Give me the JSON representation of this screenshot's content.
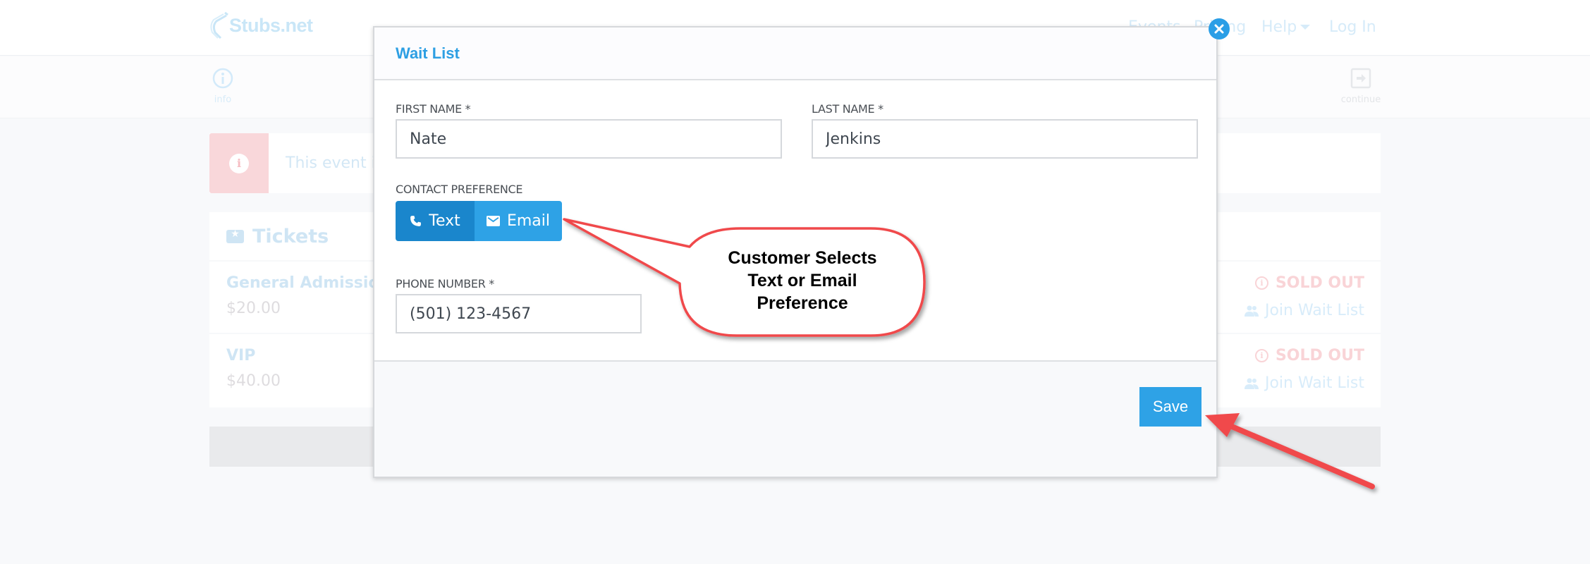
{
  "site": {
    "logo_text": "Stubs.net",
    "nav": [
      {
        "label": "Events"
      },
      {
        "label": "Pricing"
      },
      {
        "label": "Help",
        "has_dropdown": true
      },
      {
        "label": "Log In"
      }
    ],
    "steps": {
      "info_label": "info",
      "continue_label": "continue"
    }
  },
  "alert": {
    "icon": "info-icon",
    "text": "This event is"
  },
  "tickets": {
    "title": "Tickets",
    "items": [
      {
        "name": "General Admission",
        "price": "$20.00",
        "status": "SOLD OUT",
        "action": "Join Wait List"
      },
      {
        "name": "VIP",
        "price": "$40.00",
        "status": "SOLD OUT",
        "action": "Join Wait List"
      }
    ]
  },
  "modal": {
    "title": "Wait List",
    "first_name": {
      "label": "FIRST NAME *",
      "value": "Nate"
    },
    "last_name": {
      "label": "LAST NAME *",
      "value": "Jenkins"
    },
    "contact_preference": {
      "label": "CONTACT PREFERENCE",
      "options": [
        {
          "label": "Text",
          "icon": "phone-icon",
          "selected": true
        },
        {
          "label": "Email",
          "icon": "envelope-icon",
          "selected": false
        }
      ]
    },
    "phone": {
      "label": "PHONE NUMBER *",
      "value": "(501) 123-4567"
    },
    "save_label": "Save",
    "close_icon": "close-icon"
  },
  "annotation": {
    "callout_lines": [
      "Customer Selects",
      "Text or Email",
      "Preference"
    ],
    "color": "#f0484b"
  },
  "colors": {
    "brand": "#2ea2e6",
    "brand_dark": "#1a86cc",
    "danger_faded": "#f9d4d7"
  }
}
